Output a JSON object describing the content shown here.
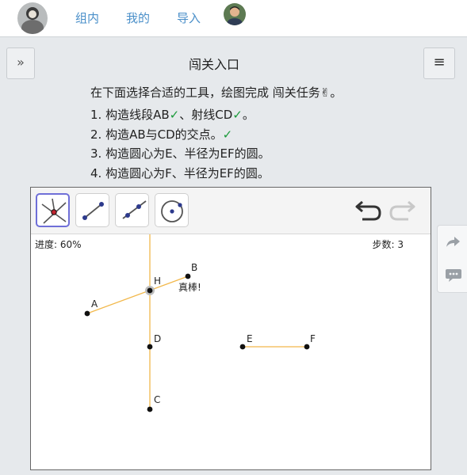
{
  "nav": {
    "links": [
      "组内",
      "我的",
      "导入"
    ]
  },
  "header": {
    "toggle_glyph": "»",
    "title": "闯关入口",
    "menu_glyph": "≡"
  },
  "instructions": {
    "intro": "在下面选择合适的工具，绘图完成 闯关任务✌。",
    "tasks": [
      {
        "text": "1.  构造线段AB✓、射线CD✓。"
      },
      {
        "text": "2.  构造AB与CD的交点。✓"
      },
      {
        "text": "3.  构造圆心为E、半径为EF的圆。"
      },
      {
        "text": "4.  构造圆心为F、半径为EF的圆。"
      }
    ]
  },
  "tools": [
    {
      "icon": "intersect-tool-icon",
      "selected": true
    },
    {
      "icon": "segment-tool-icon",
      "selected": false
    },
    {
      "icon": "ray-tool-icon",
      "selected": false
    },
    {
      "icon": "circle-tool-icon",
      "selected": false
    }
  ],
  "canvas": {
    "progress_label": "进度: 60%",
    "progress": 0.6,
    "steps_label": "步数: 3",
    "feedback": "真棒!",
    "points": {
      "A": "A",
      "B": "B",
      "H": "H",
      "D": "D",
      "C": "C",
      "E": "E",
      "F": "F"
    }
  },
  "colors": {
    "accent_link": "#4a8fc9",
    "check": "#1a9a3a",
    "construction_line": "#f2b84b",
    "point": "#111111",
    "selected_tool_border": "#6f6fd8"
  }
}
